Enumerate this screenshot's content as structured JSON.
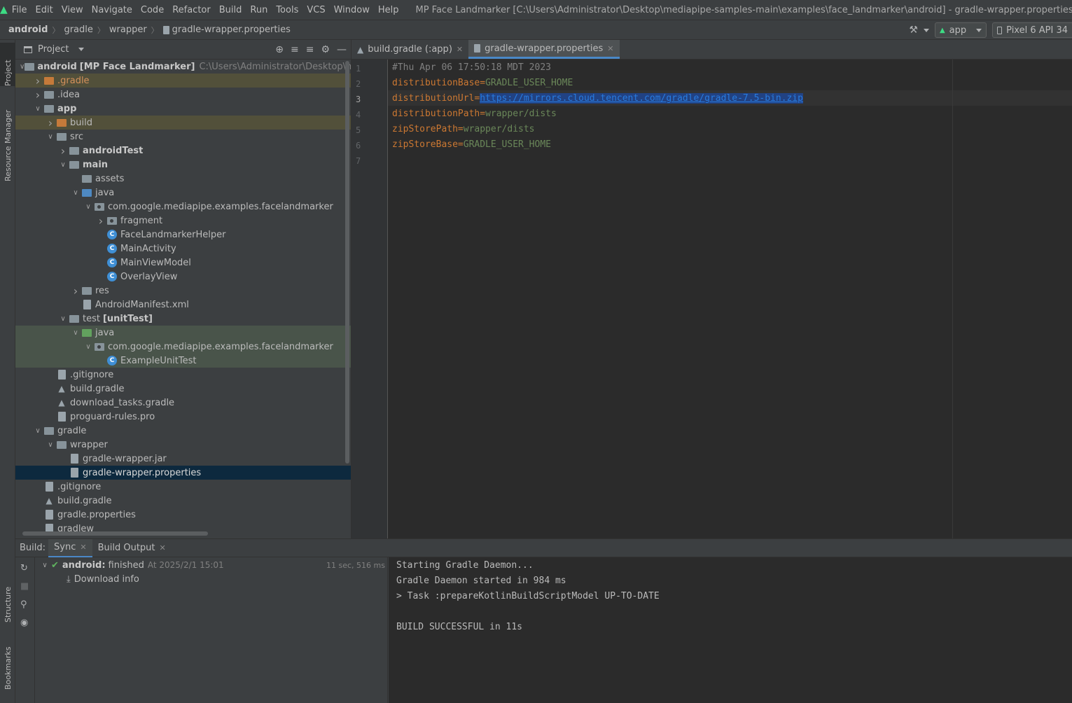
{
  "menubar": {
    "items": [
      "File",
      "Edit",
      "View",
      "Navigate",
      "Code",
      "Refactor",
      "Build",
      "Run",
      "Tools",
      "VCS",
      "Window",
      "Help"
    ],
    "window_title": "MP Face Landmarker [C:\\Users\\Administrator\\Desktop\\mediapipe-samples-main\\examples\\face_landmarker\\android] - gradle-wrapper.properties [MP_Face_Lan"
  },
  "navbar": {
    "breadcrumb": [
      "android",
      "gradle",
      "wrapper",
      "gradle-wrapper.properties"
    ],
    "run_config": "app",
    "device": "Pixel 6 API 34"
  },
  "left_strip": {
    "project": "Project",
    "resource_manager": "Resource Manager",
    "structure": "Structure",
    "bookmarks": "Bookmarks"
  },
  "project_panel": {
    "title": "Project",
    "tree": [
      {
        "label": "android",
        "extra": "[MP Face Landmarker]",
        "path": "C:\\Users\\Administrator\\Desktop\\mediapi",
        "depth": 0,
        "chev": "v",
        "icon": "folder",
        "bold": true
      },
      {
        "label": ".gradle",
        "depth": 1,
        "chev": ">",
        "icon": "folder-orange",
        "orange": true,
        "hl": "build"
      },
      {
        "label": ".idea",
        "depth": 1,
        "chev": ">",
        "icon": "folder"
      },
      {
        "label": "app",
        "depth": 1,
        "chev": "v",
        "icon": "folder-module",
        "bold": true
      },
      {
        "label": "build",
        "depth": 2,
        "chev": ">",
        "icon": "folder-orange",
        "hl": "build"
      },
      {
        "label": "src",
        "depth": 2,
        "chev": "v",
        "icon": "folder"
      },
      {
        "label": "androidTest",
        "depth": 3,
        "chev": ">",
        "icon": "folder-module",
        "bold": true
      },
      {
        "label": "main",
        "depth": 3,
        "chev": "v",
        "icon": "folder-module",
        "bold": true
      },
      {
        "label": "assets",
        "depth": 4,
        "chev": "",
        "icon": "folder-module"
      },
      {
        "label": "java",
        "depth": 4,
        "chev": "v",
        "icon": "folder-blue"
      },
      {
        "label": "com.google.mediapipe.examples.facelandmarker",
        "depth": 5,
        "chev": "v",
        "icon": "folder-pkg"
      },
      {
        "label": "fragment",
        "depth": 6,
        "chev": ">",
        "icon": "folder-pkg"
      },
      {
        "label": "FaceLandmarkerHelper",
        "depth": 6,
        "chev": "",
        "icon": "class"
      },
      {
        "label": "MainActivity",
        "depth": 6,
        "chev": "",
        "icon": "class"
      },
      {
        "label": "MainViewModel",
        "depth": 6,
        "chev": "",
        "icon": "class"
      },
      {
        "label": "OverlayView",
        "depth": 6,
        "chev": "",
        "icon": "class"
      },
      {
        "label": "res",
        "depth": 4,
        "chev": ">",
        "icon": "folder-module"
      },
      {
        "label": "AndroidManifest.xml",
        "depth": 4,
        "chev": "",
        "icon": "file"
      },
      {
        "label": "test",
        "extra": "[unitTest]",
        "depth": 3,
        "chev": "v",
        "icon": "folder-module"
      },
      {
        "label": "java",
        "depth": 4,
        "chev": "v",
        "icon": "folder-green",
        "hl": "test"
      },
      {
        "label": "com.google.mediapipe.examples.facelandmarker",
        "depth": 5,
        "chev": "v",
        "icon": "folder-pkg",
        "hl": "test"
      },
      {
        "label": "ExampleUnitTest",
        "depth": 6,
        "chev": "",
        "icon": "class",
        "hl": "test"
      },
      {
        "label": ".gitignore",
        "depth": 2,
        "chev": "",
        "icon": "file"
      },
      {
        "label": "build.gradle",
        "depth": 2,
        "chev": "",
        "icon": "gradle"
      },
      {
        "label": "download_tasks.gradle",
        "depth": 2,
        "chev": "",
        "icon": "gradle"
      },
      {
        "label": "proguard-rules.pro",
        "depth": 2,
        "chev": "",
        "icon": "file"
      },
      {
        "label": "gradle",
        "depth": 1,
        "chev": "v",
        "icon": "folder"
      },
      {
        "label": "wrapper",
        "depth": 2,
        "chev": "v",
        "icon": "folder"
      },
      {
        "label": "gradle-wrapper.jar",
        "depth": 3,
        "chev": "",
        "icon": "file"
      },
      {
        "label": "gradle-wrapper.properties",
        "depth": 3,
        "chev": "",
        "icon": "file",
        "selected": true
      },
      {
        "label": ".gitignore",
        "depth": 1,
        "chev": "",
        "icon": "file"
      },
      {
        "label": "build.gradle",
        "depth": 1,
        "chev": "",
        "icon": "gradle"
      },
      {
        "label": "gradle.properties",
        "depth": 1,
        "chev": "",
        "icon": "file"
      },
      {
        "label": "gradlew",
        "depth": 1,
        "chev": "",
        "icon": "file"
      }
    ]
  },
  "editor": {
    "tabs": [
      {
        "label": "build.gradle (:app)",
        "active": false
      },
      {
        "label": "gradle-wrapper.properties",
        "active": true
      }
    ],
    "current_line": 3,
    "lines": [
      {
        "comment": "#Thu Apr 06 17:50:18 MDT 2023"
      },
      {
        "key": "distributionBase",
        "value": "GRADLE_USER_HOME"
      },
      {
        "key": "distributionUrl",
        "url": "https://mirrors.cloud.tencent.com/gradle/gradle-7.5-bin.zip"
      },
      {
        "key": "distributionPath",
        "value": "wrapper/dists"
      },
      {
        "key": "zipStorePath",
        "value": "wrapper/dists"
      },
      {
        "key": "zipStoreBase",
        "value": "GRADLE_USER_HOME"
      },
      {}
    ]
  },
  "build_panel": {
    "label": "Build:",
    "tabs": [
      {
        "label": "Sync",
        "active": true
      },
      {
        "label": "Build Output",
        "active": false
      }
    ],
    "tree": {
      "root_name": "android:",
      "root_status": "finished",
      "root_time": "At 2025/2/1 15:01",
      "duration": "11 sec, 516 ms",
      "child": "Download info"
    },
    "output": [
      "Starting Gradle Daemon...",
      "Gradle Daemon started in 984 ms",
      "> Task :prepareKotlinBuildScriptModel UP-TO-DATE",
      "",
      "BUILD SUCCESSFUL in 11s"
    ]
  }
}
